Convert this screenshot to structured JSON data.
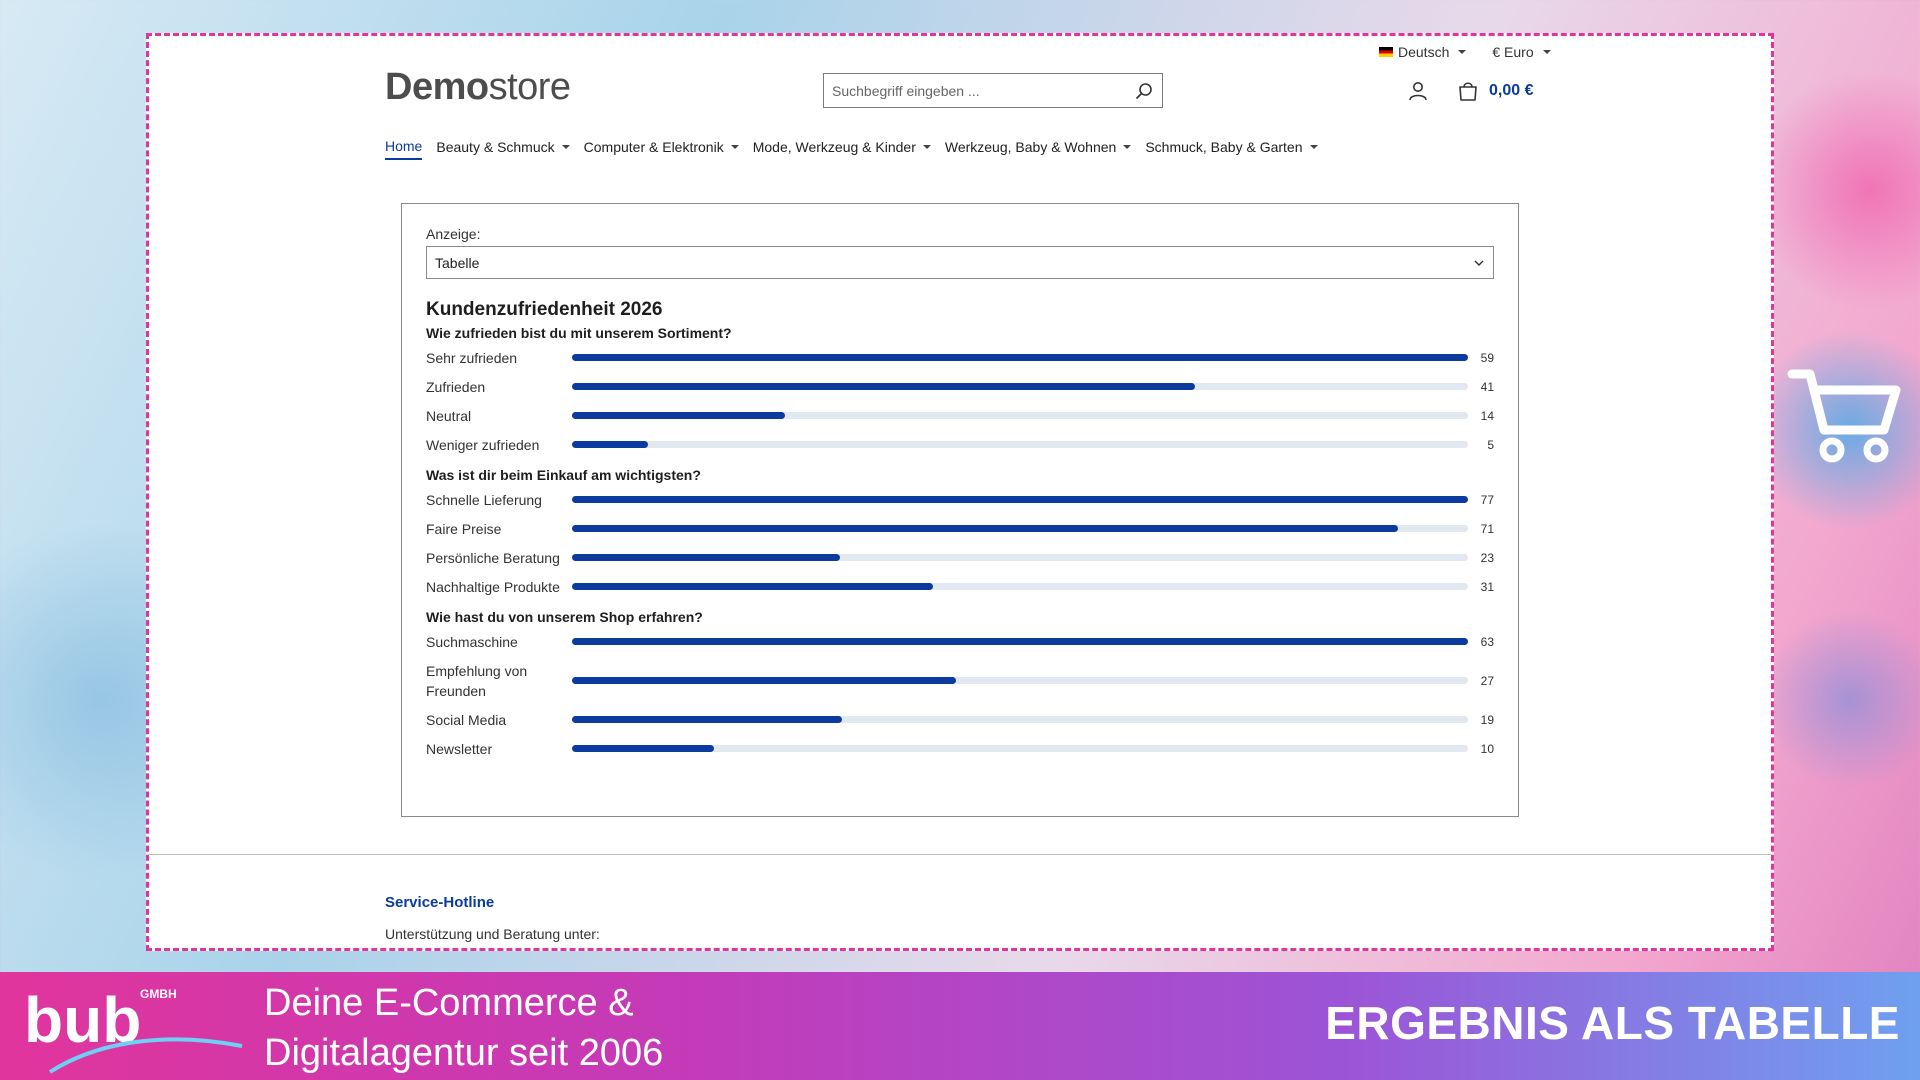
{
  "topbar": {
    "language": "Deutsch",
    "currency": "€ Euro"
  },
  "logo": {
    "bold": "Demo",
    "light": "store"
  },
  "search": {
    "placeholder": "Suchbegriff eingeben ..."
  },
  "cart": {
    "total": "0,00 €"
  },
  "nav": [
    {
      "label": "Home",
      "active": true,
      "dropdown": false
    },
    {
      "label": "Beauty & Schmuck",
      "dropdown": true
    },
    {
      "label": "Computer & Elektronik",
      "dropdown": true
    },
    {
      "label": "Mode, Werkzeug & Kinder",
      "dropdown": true
    },
    {
      "label": "Werkzeug, Baby & Wohnen",
      "dropdown": true
    },
    {
      "label": "Schmuck, Baby & Garten",
      "dropdown": true
    }
  ],
  "poll": {
    "display_label": "Anzeige:",
    "display_value": "Tabelle",
    "title": "Kundenzufriedenheit 2026",
    "questions": [
      {
        "title": "Wie zufrieden bist du mit unserem Sortiment?",
        "answers": [
          {
            "label": "Sehr zufrieden",
            "count": 59
          },
          {
            "label": "Zufrieden",
            "count": 41
          },
          {
            "label": "Neutral",
            "count": 14
          },
          {
            "label": "Weniger zufrieden",
            "count": 5
          }
        ]
      },
      {
        "title": "Was ist dir beim Einkauf am wichtigsten?",
        "answers": [
          {
            "label": "Schnelle Lieferung",
            "count": 77
          },
          {
            "label": "Faire Preise",
            "count": 71
          },
          {
            "label": "Persönliche Beratung",
            "count": 23
          },
          {
            "label": "Nachhaltige Produkte",
            "count": 31
          }
        ]
      },
      {
        "title": "Wie hast du von unserem Shop erfahren?",
        "answers": [
          {
            "label": "Suchmaschine",
            "count": 63
          },
          {
            "label": "Empfehlung von Freunden",
            "count": 27
          },
          {
            "label": "Social Media",
            "count": 19
          },
          {
            "label": "Newsletter",
            "count": 10
          }
        ]
      }
    ]
  },
  "footer": {
    "hotline_title": "Service-Hotline",
    "support_text": "Unterstützung und Beratung unter:"
  },
  "banner": {
    "brand_main": "bub",
    "brand_suffix": "GMBH",
    "tagline_line1": "Deine E-Commerce &",
    "tagline_line2": "Digitalagentur seit 2006",
    "result_label": "ERGEBNIS ALS TABELLE"
  },
  "colors": {
    "accent": "#0b3b9c",
    "frame_border": "#e0359c",
    "bar_track": "#e2e8ef"
  }
}
